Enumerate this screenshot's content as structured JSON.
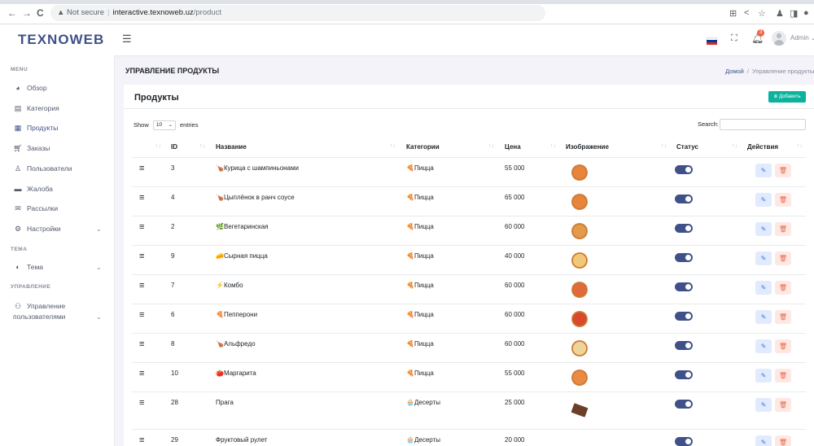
{
  "browser": {
    "back_icon": "←",
    "forward_icon": "→",
    "reload_icon": "C",
    "warning_icon": "▲",
    "not_secure": "Not secure",
    "host": "interactive.texnoweb.uz",
    "path": "/product"
  },
  "header": {
    "logo": "TEXNOWEB",
    "notification_count": "3",
    "user": "Admin"
  },
  "sidebar": {
    "menu_label": "MENU",
    "theme_label": "ТЕМА",
    "manage_label": "УПРАВЛЕНИЕ",
    "items": [
      {
        "label": "Обзор"
      },
      {
        "label": "Категория"
      },
      {
        "label": "Продукты"
      },
      {
        "label": "Заказы"
      },
      {
        "label": "Пользователи"
      },
      {
        "label": "Жалоба"
      },
      {
        "label": "Рассылки"
      },
      {
        "label": "Настройки"
      }
    ],
    "theme_item": "Тема",
    "users_mgmt_line1": "Управление",
    "users_mgmt_line2": "пользователями"
  },
  "page": {
    "title": "УПРАВЛЕНИЕ ПРОДУКТЫ",
    "breadcrumb_home": "Домой",
    "breadcrumb_current": "Управление продукты"
  },
  "card": {
    "title": "Продукты",
    "add_button": "Добавить",
    "show_label": "Show",
    "entries_value": "10",
    "entries_label": "entries",
    "search_label": "Search:"
  },
  "table": {
    "columns": [
      "ID",
      "Название",
      "Категории",
      "Цена",
      "Изображение",
      "Статус",
      "Действия"
    ],
    "rows": [
      {
        "id": "3",
        "emoji": "🍗",
        "name": "Курица с шампиньонами",
        "cat_emoji": "🍕",
        "category": "Пицца",
        "price": "55 000",
        "status": true
      },
      {
        "id": "4",
        "emoji": "🍗",
        "name": "Цыплёнок в ранч соусе",
        "cat_emoji": "🍕",
        "category": "Пицца",
        "price": "65 000",
        "status": true
      },
      {
        "id": "2",
        "emoji": "🌿",
        "name": "Вегетаринская",
        "cat_emoji": "🍕",
        "category": "Пицца",
        "price": "60 000",
        "status": true
      },
      {
        "id": "9",
        "emoji": "🧀",
        "name": "Сырная пицца",
        "cat_emoji": "🍕",
        "category": "Пицца",
        "price": "40 000",
        "status": true
      },
      {
        "id": "7",
        "emoji": "⚡",
        "name": "Комбо",
        "cat_emoji": "🍕",
        "category": "Пицца",
        "price": "60 000",
        "status": true
      },
      {
        "id": "6",
        "emoji": "🍕",
        "name": "Пепперони",
        "cat_emoji": "🍕",
        "category": "Пицца",
        "price": "60 000",
        "status": true
      },
      {
        "id": "8",
        "emoji": "🍗",
        "name": "Альфредо",
        "cat_emoji": "🍕",
        "category": "Пицца",
        "price": "60 000",
        "status": true
      },
      {
        "id": "10",
        "emoji": "🍅",
        "name": "Маргарита",
        "cat_emoji": "🍕",
        "category": "Пицца",
        "price": "55 000",
        "status": true
      },
      {
        "id": "28",
        "emoji": "",
        "name": "Прага",
        "cat_emoji": "🧁",
        "category": "Десерты",
        "price": "25 000",
        "status": true
      },
      {
        "id": "29",
        "emoji": "",
        "name": "Фруктовый рулет",
        "cat_emoji": "🧁",
        "category": "Десерты",
        "price": "20 000",
        "status": true
      }
    ]
  },
  "colors": {
    "primary": "#405189",
    "success": "#0ab39c",
    "danger": "#f06548"
  }
}
